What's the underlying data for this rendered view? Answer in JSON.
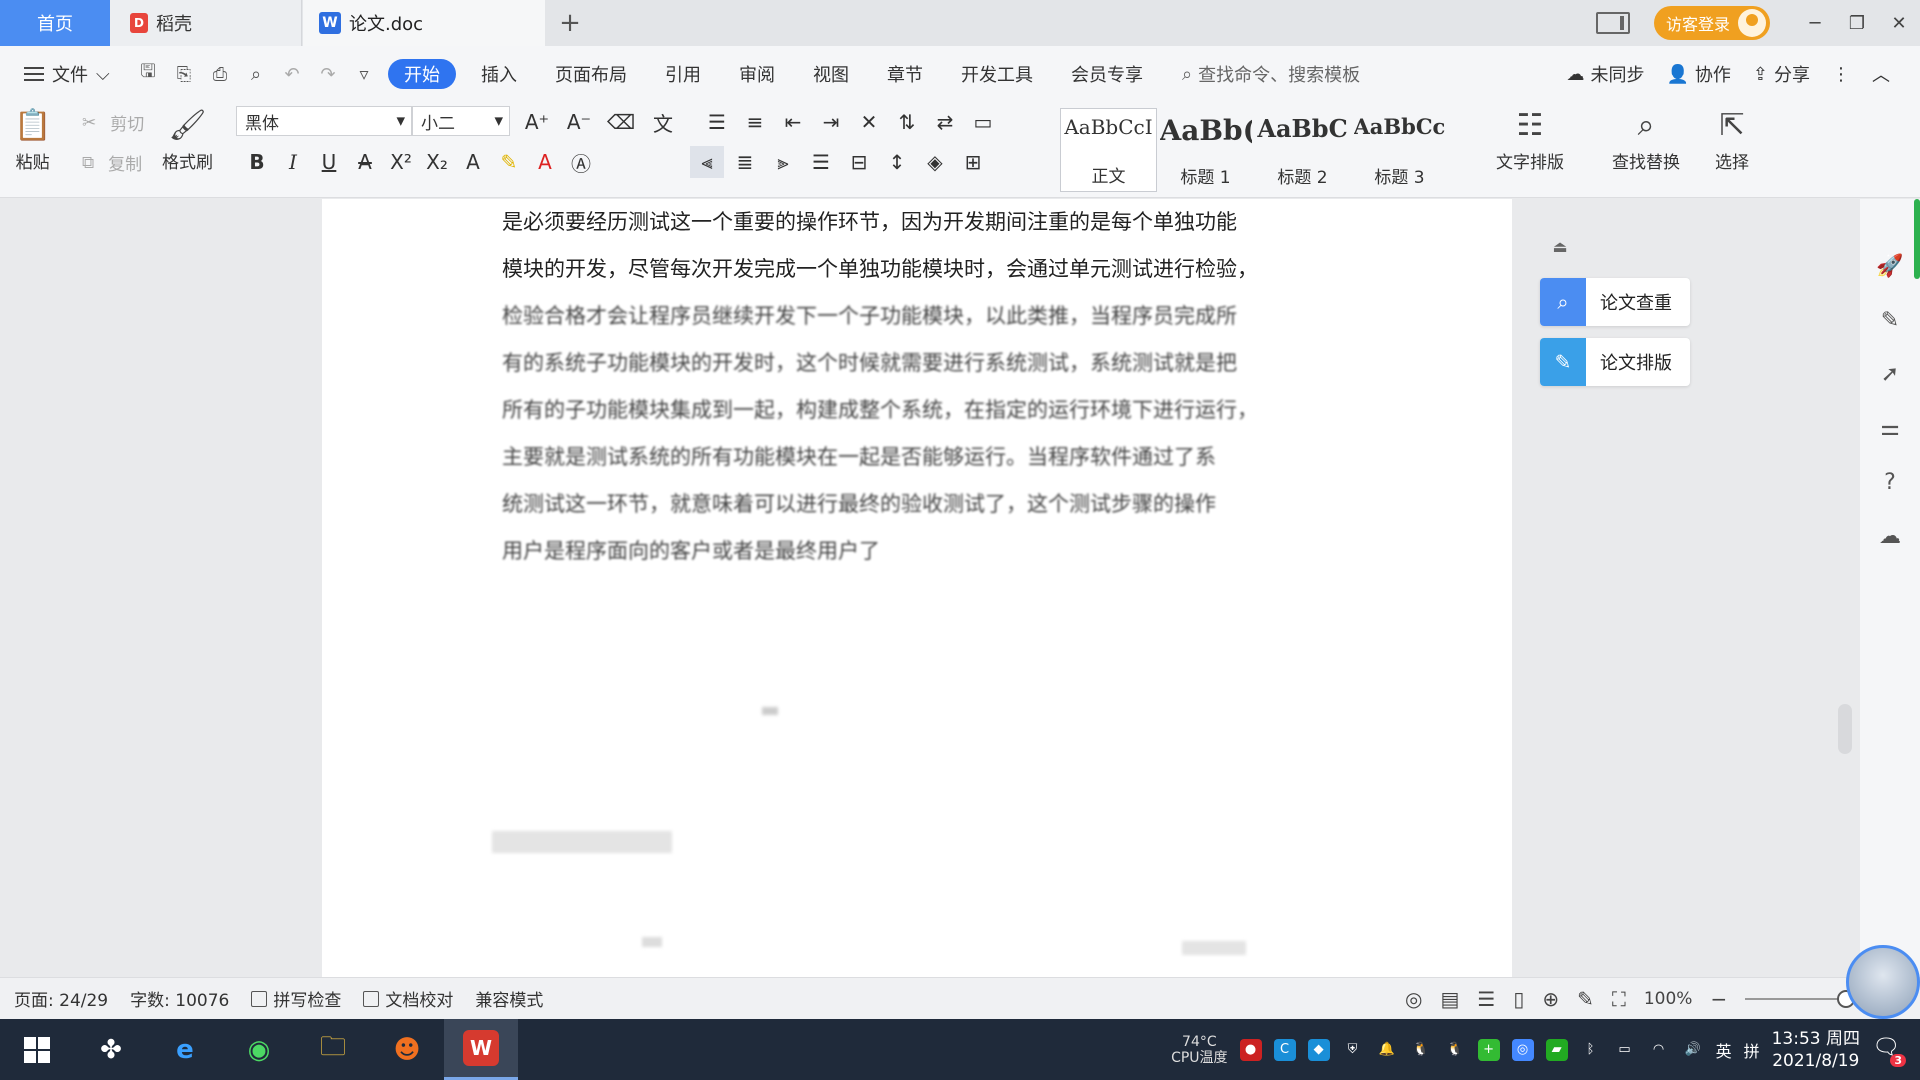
{
  "tabs": {
    "home": "首页",
    "daoke": "稻壳",
    "doc": "论文.doc",
    "add": "+"
  },
  "titlebar": {
    "visitor_login": "访客登录"
  },
  "menubar": {
    "file": "文件",
    "tabs": [
      "开始",
      "插入",
      "页面布局",
      "引用",
      "审阅",
      "视图",
      "章节",
      "开发工具",
      "会员专享"
    ],
    "active_tab": "开始",
    "search_placeholder": "查找命令、搜索模板",
    "unsynced": "未同步",
    "collab": "协作",
    "share": "分享"
  },
  "ribbon": {
    "paste": "粘贴",
    "cut": "剪切",
    "copy": "复制",
    "format_painter": "格式刷",
    "font_name": "黑体",
    "font_size": "小二",
    "styles": [
      {
        "sample": "AaBbCcI",
        "label": "正文"
      },
      {
        "sample": "AaBb(",
        "label": "标题 1"
      },
      {
        "sample": "AaBbC",
        "label": "标题 2"
      },
      {
        "sample": "AaBbCcl",
        "label": "标题 3"
      }
    ],
    "text_layout": "文字排版",
    "find_replace": "查找替换",
    "select": "选择"
  },
  "document": {
    "lines": [
      "是必须要经历测试这一个重要的操作环节，因为开发期间注重的是每个单独功能",
      "模块的开发，尽管每次开发完成一个单独功能模块时，会通过单元测试进行检验，",
      "检验合格才会让程序员继续开发下一个子功能模块，以此类推，当程序员完成所",
      "有的系统子功能模块的开发时，这个时候就需要进行系统测试，系统测试就是把",
      "所有的子功能模块集成到一起，构建成整个系统，在指定的运行环境下进行运行，",
      "主要就是测试系统的所有功能模块在一起是否能够运行。当程序软件通过了系",
      "统测试这一环节，就意味着可以进行最终的验收测试了，这个测试步骤的操作",
      "用户是程序面向的客户或者是最终用户了"
    ]
  },
  "side_panel": {
    "check": "论文查重",
    "layout": "论文排版"
  },
  "statusbar": {
    "page": "页面: 24/29",
    "words": "字数: 10076",
    "spell_check": "拼写检查",
    "doc_proof": "文档校对",
    "compat_mode": "兼容模式",
    "zoom": "100%"
  },
  "taskbar": {
    "cpu_temp": "74°C",
    "cpu_label": "CPU温度",
    "lang": "英",
    "ime": "拼",
    "time": "13:53 周四",
    "date": "2021/8/19",
    "notify_count": "3"
  },
  "colors": {
    "accent": "#2f74f0",
    "home_tab": "#4b8df2",
    "visitor": "#f0a020",
    "taskbar": "#1f2a3a",
    "wps_red": "#d63a2f"
  }
}
